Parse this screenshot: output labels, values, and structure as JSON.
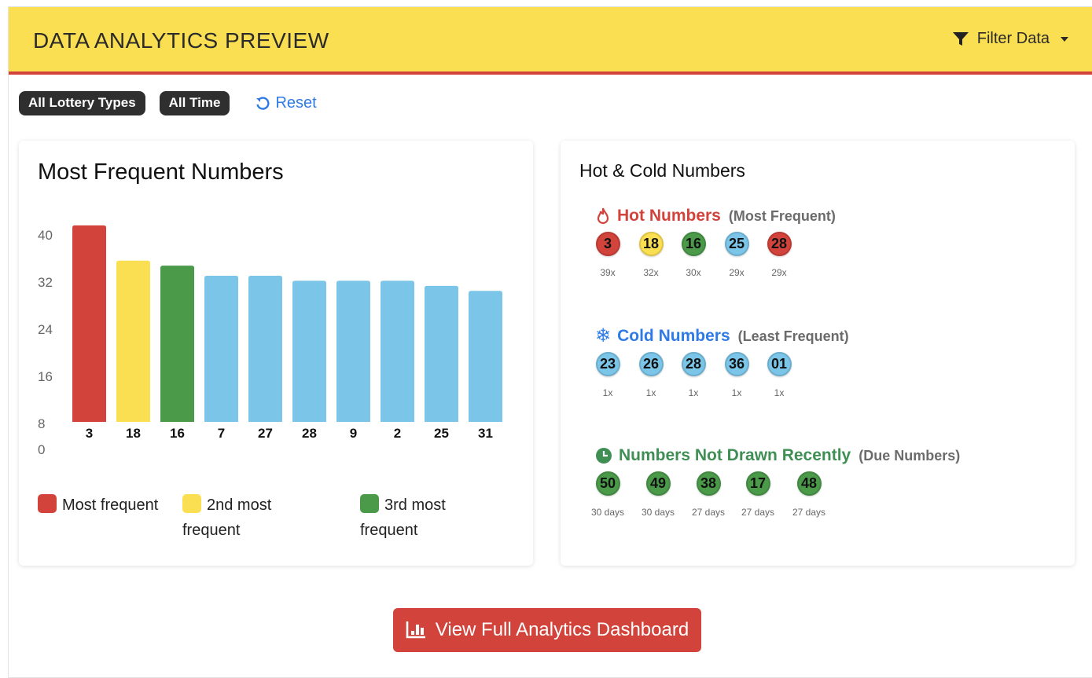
{
  "header": {
    "title": "DATA ANALYTICS PREVIEW",
    "filter_label": "Filter Data"
  },
  "filters": {
    "chips": [
      "All Lottery Types",
      "All Time"
    ],
    "reset_label": "Reset"
  },
  "frequent": {
    "title": "Most Frequent Numbers",
    "legend": [
      {
        "label": "Most frequent",
        "color": "#d1433b"
      },
      {
        "label": "2nd most frequent",
        "color": "#fbdf52"
      },
      {
        "label": "3rd most frequent",
        "color": "#4a9a4a"
      }
    ]
  },
  "chart_data": {
    "type": "bar",
    "categories": [
      "3",
      "18",
      "16",
      "7",
      "27",
      "28",
      "9",
      "2",
      "25",
      "31"
    ],
    "values": [
      39,
      32,
      31,
      29,
      29,
      28,
      28,
      28,
      27,
      26
    ],
    "colors": [
      "#d1433b",
      "#fbdf52",
      "#4a9a4a",
      "#7bc5e8",
      "#7bc5e8",
      "#7bc5e8",
      "#7bc5e8",
      "#7bc5e8",
      "#7bc5e8",
      "#7bc5e8"
    ],
    "y_ticks": [
      40,
      32,
      24,
      16,
      8,
      0
    ],
    "ylim": [
      0,
      40
    ],
    "grid": false
  },
  "hot_cold": {
    "title": "Hot & Cold Numbers",
    "hot": {
      "title": "Hot Numbers",
      "subtitle": "(Most Frequent)",
      "color": "#d1433b",
      "icon": "fire-icon",
      "balls": [
        {
          "num": "3",
          "sub": "39x",
          "color": "#d1433b"
        },
        {
          "num": "18",
          "sub": "32x",
          "color": "#fbdf52"
        },
        {
          "num": "16",
          "sub": "30x",
          "color": "#4a9a4a"
        },
        {
          "num": "25",
          "sub": "29x",
          "color": "#7bc5e8"
        },
        {
          "num": "28",
          "sub": "29x",
          "color": "#d1433b"
        }
      ]
    },
    "cold": {
      "title": "Cold Numbers",
      "subtitle": "(Least Frequent)",
      "color": "#2f7be6",
      "icon": "snowflake-icon",
      "balls": [
        {
          "num": "23",
          "sub": "1x",
          "color": "#7bc5e8"
        },
        {
          "num": "26",
          "sub": "1x",
          "color": "#7bc5e8"
        },
        {
          "num": "28",
          "sub": "1x",
          "color": "#7bc5e8"
        },
        {
          "num": "36",
          "sub": "1x",
          "color": "#7bc5e8"
        },
        {
          "num": "01",
          "sub": "1x",
          "color": "#7bc5e8"
        }
      ]
    },
    "due": {
      "title": "Numbers Not Drawn Recently",
      "subtitle": "(Due Numbers)",
      "color": "#3f8f55",
      "icon": "clock-icon",
      "balls": [
        {
          "num": "50",
          "sub": "30 days",
          "color": "#4a9a4a"
        },
        {
          "num": "49",
          "sub": "30 days",
          "color": "#4a9a4a"
        },
        {
          "num": "38",
          "sub": "27 days",
          "color": "#4a9a4a"
        },
        {
          "num": "17",
          "sub": "27 days",
          "color": "#4a9a4a"
        },
        {
          "num": "48",
          "sub": "27 days",
          "color": "#4a9a4a"
        }
      ]
    }
  },
  "cta": {
    "label": "View Full Analytics Dashboard"
  }
}
